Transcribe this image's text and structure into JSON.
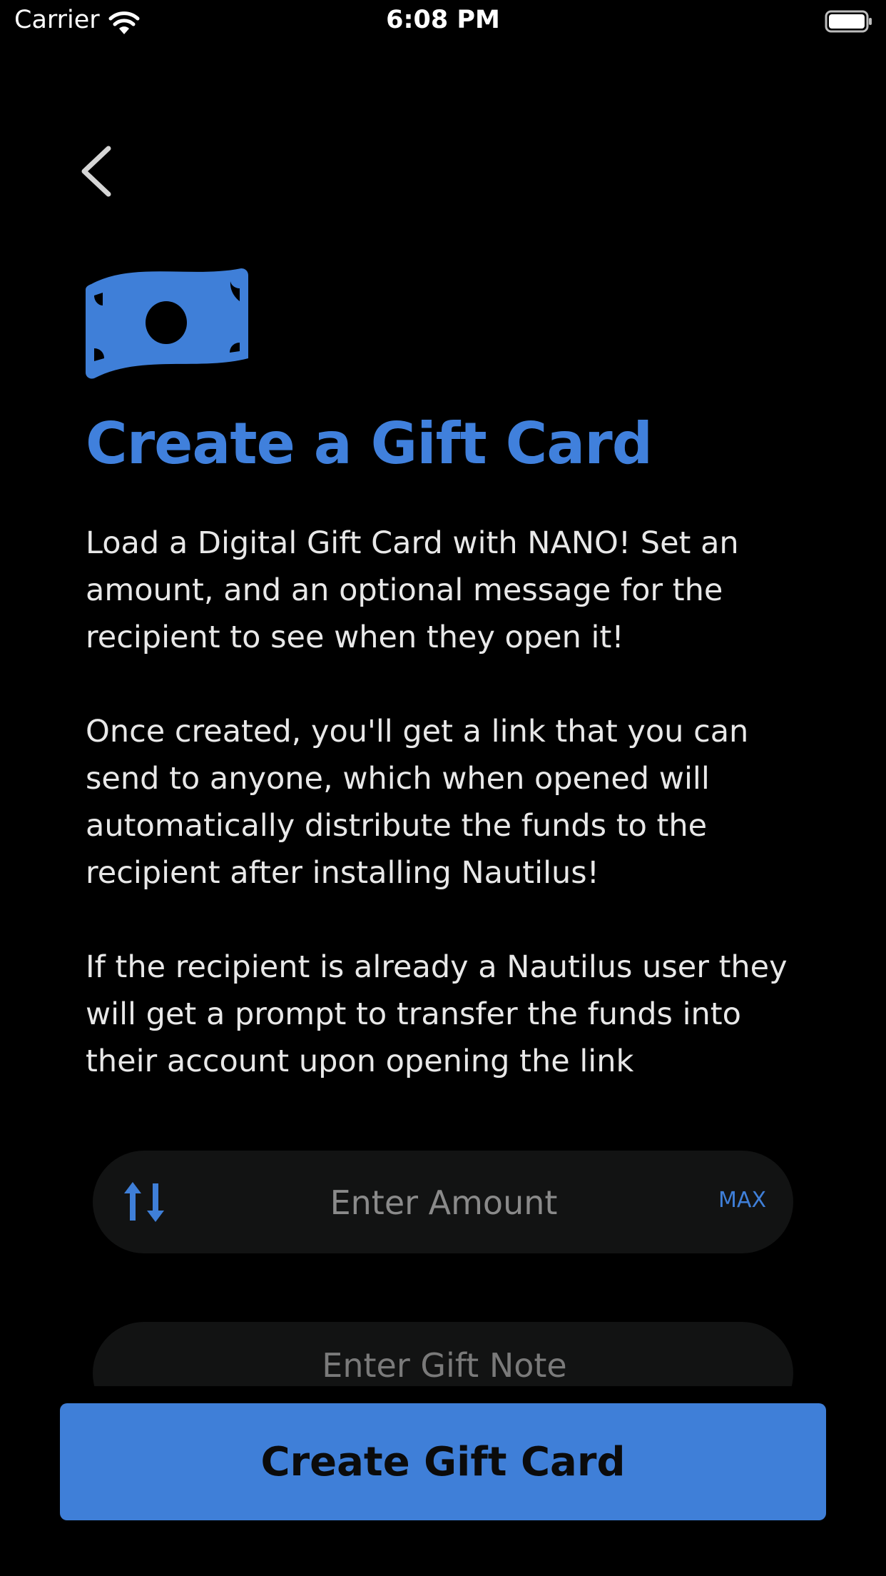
{
  "status_bar": {
    "carrier": "Carrier",
    "time": "6:08 PM",
    "icons": [
      "wifi-icon",
      "battery-icon"
    ]
  },
  "header": {
    "back_icon": "chevron-left-icon"
  },
  "hero": {
    "icon": "money-bill-icon",
    "title": "Create a Gift Card"
  },
  "description": {
    "paragraph_1": "Load a Digital Gift Card with NANO! Set an amount, and an optional message for the recipient to see when they open it!",
    "paragraph_2": "Once created, you'll get a link that you can send to anyone, which when opened will automatically distribute the funds to the recipient after installing Nautilus!",
    "paragraph_3": "If the recipient is already a Nautilus user they will get a prompt to transfer the funds into their account upon opening the link"
  },
  "amount_field": {
    "icon": "swap-arrows-icon",
    "value": "",
    "placeholder": "Enter Amount",
    "max_label": "MAX"
  },
  "note_field": {
    "value": "",
    "placeholder": "Enter Gift Note"
  },
  "actions": {
    "create_label": "Create Gift Card"
  },
  "colors": {
    "background": "#000000",
    "accent": "#3f7fd8",
    "field_background": "#121313",
    "text": "#e8e8e8",
    "placeholder": "#8a8a8a"
  }
}
